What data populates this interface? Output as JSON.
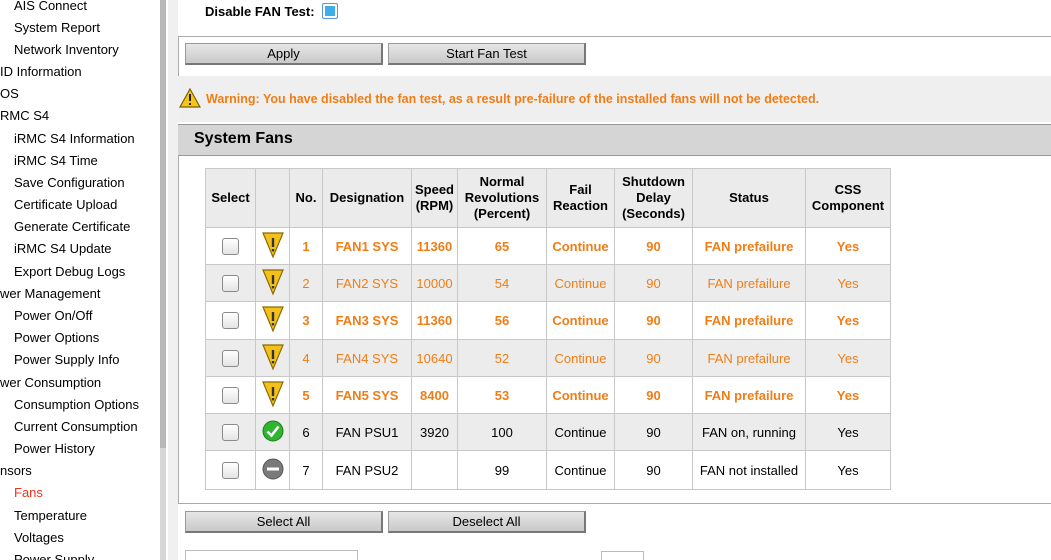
{
  "sidebar": {
    "items": [
      {
        "label": "AIS Connect",
        "level": "sub"
      },
      {
        "label": "System Report",
        "level": "sub"
      },
      {
        "label": "Network Inventory",
        "level": "sub"
      },
      {
        "label": "ID Information",
        "level": "top"
      },
      {
        "label": "OS",
        "level": "top"
      },
      {
        "label": "RMC S4",
        "level": "top"
      },
      {
        "label": "iRMC S4 Information",
        "level": "sub"
      },
      {
        "label": "iRMC S4 Time",
        "level": "sub"
      },
      {
        "label": "Save Configuration",
        "level": "sub"
      },
      {
        "label": "Certificate Upload",
        "level": "sub"
      },
      {
        "label": "Generate Certificate",
        "level": "sub"
      },
      {
        "label": "iRMC S4 Update",
        "level": "sub"
      },
      {
        "label": "Export Debug Logs",
        "level": "sub"
      },
      {
        "label": "wer Management",
        "level": "top"
      },
      {
        "label": "Power On/Off",
        "level": "sub"
      },
      {
        "label": "Power Options",
        "level": "sub"
      },
      {
        "label": "Power Supply Info",
        "level": "sub"
      },
      {
        "label": "wer Consumption",
        "level": "top"
      },
      {
        "label": "Consumption Options",
        "level": "sub"
      },
      {
        "label": "Current Consumption",
        "level": "sub"
      },
      {
        "label": "Power History",
        "level": "sub"
      },
      {
        "label": "nsors",
        "level": "top"
      },
      {
        "label": "Fans",
        "level": "sub",
        "active": true
      },
      {
        "label": "Temperature",
        "level": "sub"
      },
      {
        "label": "Voltages",
        "level": "sub"
      },
      {
        "label": "Power Supply",
        "level": "sub"
      }
    ]
  },
  "form": {
    "disable_fan_test_label": "Disable FAN Test:",
    "disable_fan_test_checked": true,
    "apply_label": "Apply",
    "start_fan_test_label": "Start Fan Test"
  },
  "warning": {
    "text": "Warning: You have disabled the fan test, as a result pre-failure of the installed fans will not be detected.",
    "color": "#f07d16"
  },
  "section_title": "System Fans",
  "table": {
    "headers": [
      "Select",
      "",
      "No.",
      "Designation",
      "Speed\n(RPM)",
      "Normal\nRevolutions\n(Percent)",
      "Fail\nReaction",
      "Shutdown\nDelay\n(Seconds)",
      "Status",
      "CSS\nComponent"
    ],
    "rows": [
      {
        "icon": "warning-icon",
        "no": "1",
        "designation": "FAN1 SYS",
        "speed": "11360",
        "percent": "65",
        "reaction": "Continue",
        "delay": "90",
        "status": "FAN prefailure",
        "css": "Yes",
        "style": "warn-bold"
      },
      {
        "icon": "warning-icon",
        "no": "2",
        "designation": "FAN2 SYS",
        "speed": "10000",
        "percent": "54",
        "reaction": "Continue",
        "delay": "90",
        "status": "FAN prefailure",
        "css": "Yes",
        "style": "warn-norm"
      },
      {
        "icon": "warning-icon",
        "no": "3",
        "designation": "FAN3 SYS",
        "speed": "11360",
        "percent": "56",
        "reaction": "Continue",
        "delay": "90",
        "status": "FAN prefailure",
        "css": "Yes",
        "style": "warn-bold"
      },
      {
        "icon": "warning-icon",
        "no": "4",
        "designation": "FAN4 SYS",
        "speed": "10640",
        "percent": "52",
        "reaction": "Continue",
        "delay": "90",
        "status": "FAN prefailure",
        "css": "Yes",
        "style": "warn-norm"
      },
      {
        "icon": "warning-icon",
        "no": "5",
        "designation": "FAN5 SYS",
        "speed": "8400",
        "percent": "53",
        "reaction": "Continue",
        "delay": "90",
        "status": "FAN prefailure",
        "css": "Yes",
        "style": "warn-bold"
      },
      {
        "icon": "ok-check-icon",
        "no": "6",
        "designation": "FAN PSU1",
        "speed": "3920",
        "percent": "100",
        "reaction": "Continue",
        "delay": "90",
        "status": "FAN on, running",
        "css": "Yes",
        "style": "normal"
      },
      {
        "icon": "not-installed-icon",
        "no": "7",
        "designation": "FAN PSU2",
        "speed": "",
        "percent": "99",
        "reaction": "Continue",
        "delay": "90",
        "status": "FAN not installed",
        "css": "Yes",
        "style": "normal"
      }
    ]
  },
  "buttons": {
    "select_all": "Select All",
    "deselect_all": "Deselect All"
  },
  "colors": {
    "warning": "#f07d16",
    "active_nav": "#e8351f",
    "ok": "#2fb52f",
    "not_installed": "#777777"
  }
}
